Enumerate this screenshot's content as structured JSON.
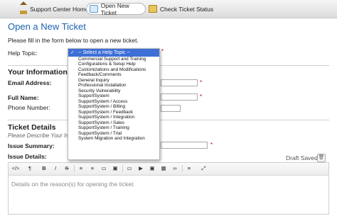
{
  "nav": {
    "tabs": [
      {
        "label": "Support Center Home",
        "icon": "home-icon"
      },
      {
        "label": "Open New Ticket",
        "icon": "new-ticket-icon",
        "active": true
      },
      {
        "label": "Check Ticket Status",
        "icon": "ticket-status-icon"
      }
    ]
  },
  "page": {
    "title": "Open a New Ticket",
    "intro": "Please fill in the form below to open a new ticket."
  },
  "help_topic": {
    "label": "Help Topic:",
    "selected": "-- Select a Help Topic --",
    "options": [
      "Commercial Support and Training",
      "Configurations & Setup Help",
      "Customizations and Modifications",
      "Feedback/Comments",
      "General Inquiry",
      "Professional Installation",
      "Security Vulnerability",
      "SupportSystem",
      "SupportSystem / Access",
      "SupportSystem / Billing",
      "SupportSystem / Feedback",
      "SupportSystem / Integration",
      "SupportSystem / Sales",
      "SupportSystem / Training",
      "SupportSystem / Trial",
      "System Migration and Integration"
    ]
  },
  "your_info": {
    "heading": "Your Information",
    "email_label": "Email Address:",
    "name_label": "Full Name:",
    "phone_label": "Phone Number:"
  },
  "ticket": {
    "heading": "Ticket Details",
    "hint": "Please Describe Your Issu",
    "summary_label": "Issue Summary:",
    "details_label": "Issue Details:",
    "draft_status": "Draft Saved",
    "details_placeholder": "Details on the reason(s) for opening the ticket."
  },
  "required_mark": "*",
  "editor_toolbar": [
    "</>",
    "¶",
    "B",
    "I",
    "S",
    "≡",
    "≡",
    "▭",
    "▣",
    "▶",
    "▦",
    "∞",
    "≡",
    "⤢"
  ],
  "colors": {
    "title": "#1a62b0",
    "required": "#d00000",
    "selected_option": "#3d6fd6"
  }
}
